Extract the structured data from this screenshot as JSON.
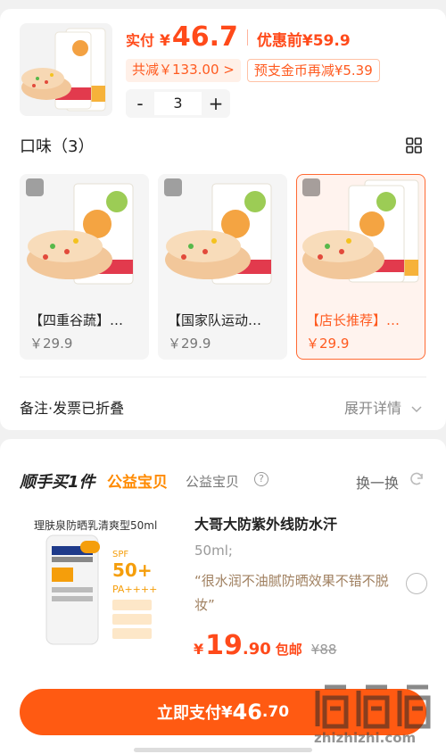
{
  "order": {
    "pay_label": "实付",
    "pay_yen": "¥",
    "pay_amount": "46.7",
    "original_price": "优惠前¥59.9",
    "discount_chip": "共减￥133.00 >",
    "coin_chip": "预支金币再减¥5.39",
    "qty_minus": "-",
    "qty": "3",
    "qty_plus": "+"
  },
  "flavor": {
    "title": "口味（3）",
    "options": [
      {
        "name": "【四重谷蔬】…",
        "price": "￥29.9",
        "selected": false
      },
      {
        "name": "【国家队运动…",
        "price": "￥29.9",
        "selected": false
      },
      {
        "name": "【店长推荐】…",
        "price": "￥29.9",
        "selected": true
      }
    ]
  },
  "notes": {
    "label": "备注·发票已折叠",
    "expand": "展开详情"
  },
  "addon": {
    "title": "顺手买1件",
    "tag": "公益宝贝",
    "subtag": "公益宝贝",
    "question_mark": "?",
    "swap_label": "换一换",
    "product": {
      "image_caption": "理肤泉防晒乳清爽型50ml",
      "title": "大哥大防紫外线防水汗",
      "spec": "50ml;",
      "quote": "“很水润不油腻防晒效果不错不脱妆”",
      "price_yen": "¥",
      "price_int": "19",
      "price_dec": ".90",
      "postage": "包邮",
      "old_price": "¥88"
    }
  },
  "pay_button": {
    "label": "立即支付",
    "yen": "¥",
    "int": "46",
    "dec": ".70"
  },
  "watermark": {
    "text": "zhizhizhi.com"
  },
  "colors": {
    "accent": "#ff5a12",
    "price": "#ff4a1a",
    "coin_chip_bg": "#fff0e8"
  }
}
